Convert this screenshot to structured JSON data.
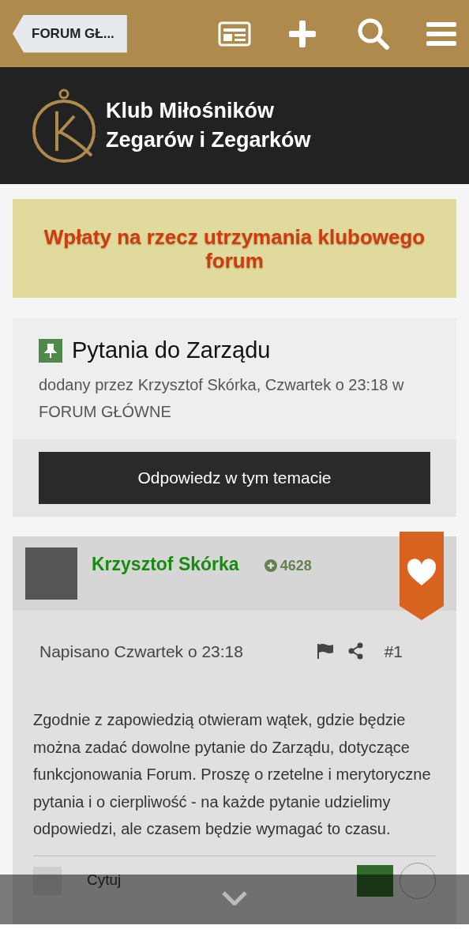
{
  "header": {
    "breadcrumb": "FORUM GŁ..."
  },
  "site": {
    "name_line1": "Klub Miłośników",
    "name_line2": "Zegarów i Zegarków"
  },
  "announcement": {
    "text": "Wpłaty na rzecz utrzymania klubowego forum"
  },
  "topic": {
    "title": "Pytania do Zarządu",
    "pinned": true,
    "meta": "dodany przez Krzysztof Skórka, Czwartek o 23:18 w FORUM GŁÓWNE",
    "reply_button": "Odpowiedz w tym temacie"
  },
  "post": {
    "author": "Krzysztof Skórka",
    "reputation": "4628",
    "liked": true,
    "posted": "Napisano Czwartek o 23:18",
    "number": "#1",
    "body": "Zgodnie z zapowiedzią otwieram wątek, gdzie będzie można zadać dowolne pytanie do Zarządu, dotyczące funkcjonowania Forum. Proszę o rzetelne i merytoryczne pytania i o cierpliwość - na każde pytanie udzielimy odpowiedzi, ale czasem będzie wymagać to czasu.",
    "quote_label": "Cytuj"
  }
}
